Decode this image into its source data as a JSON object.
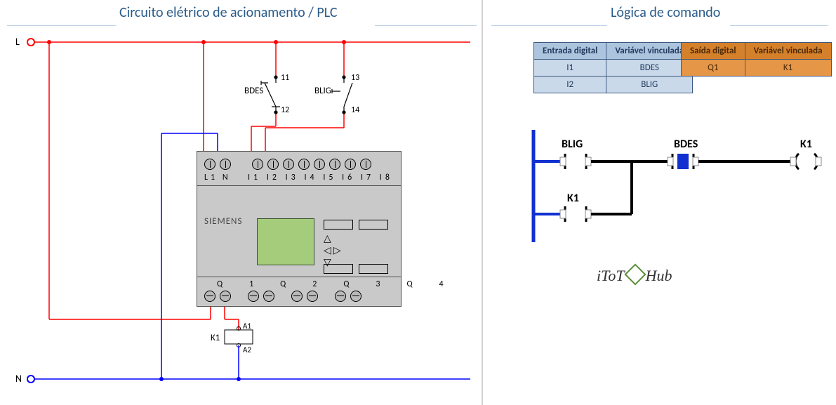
{
  "titles": {
    "left": "Circuito elétrico de acionamento / PLC",
    "right": "Lógica de comando"
  },
  "circuit": {
    "L": "L",
    "N": "N",
    "BDES": "BDES",
    "BLIG": "BLIG",
    "t11": "11",
    "t12": "12",
    "t13": "13",
    "t14": "14",
    "K1": "K1",
    "A1": "A1",
    "A2": "A2"
  },
  "plc": {
    "brand": "SIEMENS",
    "top_terms": [
      "L1",
      "N",
      "I1",
      "I2",
      "I3",
      "I4",
      "I5",
      "I6",
      "I7",
      "I8"
    ],
    "bot_terms": [
      "Q1",
      "Q2",
      "Q3",
      "Q4"
    ]
  },
  "tables": {
    "inputs": {
      "h1": "Entrada digital",
      "h2": "Variável vinculada",
      "rows": [
        [
          "I1",
          "BDES"
        ],
        [
          "I2",
          "BLIG"
        ]
      ]
    },
    "outputs": {
      "h1": "Saída digital",
      "h2": "Variável vinculada",
      "rows": [
        [
          "Q1",
          "K1"
        ]
      ]
    }
  },
  "ladder": {
    "BLIG": "BLIG",
    "BDES": "BDES",
    "K1": "K1",
    "K1b": "K1"
  },
  "logo": {
    "a": "iToT",
    "b": "Hub"
  }
}
